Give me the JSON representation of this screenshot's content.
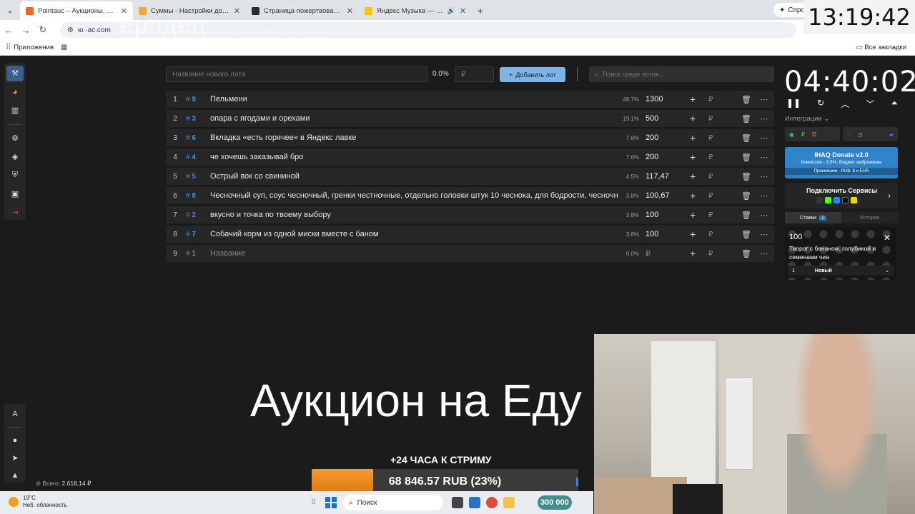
{
  "browser": {
    "tabs": [
      {
        "title": "Pointauc – Аукционы, лотереи",
        "color": "#e86a1f",
        "active": true
      },
      {
        "title": "Суммы - Настройки донатов",
        "color": "#f2a93b",
        "active": false
      },
      {
        "title": "Страница пожертвований | D",
        "color": "#2b2b2b",
        "active": false
      },
      {
        "title": "Яндекс Музыка — собира",
        "color": "#f5c518",
        "active": false,
        "audio": true
      }
    ],
    "ask_label": "Спрос",
    "url": "ю ·ac.com",
    "bookmarks_apps": "Приложения",
    "bookmarks_all": "Все закладки"
  },
  "overlay": {
    "clock": "13:19:42",
    "ghost_text": "ерлдец"
  },
  "toolbar": {
    "lot_name_placeholder": "Название нового лота",
    "percent": "0.0%",
    "price_placeholder": "₽",
    "add_label": "Добавить лот",
    "search_placeholder": "Поиск среди лотов..."
  },
  "lots": [
    {
      "num": "1",
      "id": "9",
      "name": "Пельмени",
      "pct": "49.7%",
      "amount": "1300"
    },
    {
      "num": "2",
      "id": "3",
      "name": "опара с ягодами и орехами",
      "pct": "19.1%",
      "amount": "500"
    },
    {
      "num": "3",
      "id": "6",
      "name": "Вкладка «есть горячее» в Яндекс лавке",
      "pct": "7.6%",
      "amount": "200"
    },
    {
      "num": "4",
      "id": "4",
      "name": "че хочешь заказывай бро",
      "pct": "7.6%",
      "amount": "200"
    },
    {
      "num": "5",
      "id": "5",
      "name": "Острый вок со свининой",
      "pct": "4.5%",
      "amount": "117,47"
    },
    {
      "num": "6",
      "id": "8",
      "name": "Чесночный суп, соус чесночный, гренки честночные,  отдельно головки штук 10 чеснока, для бодрости, чесночны",
      "pct": "3.8%",
      "amount": "100,67"
    },
    {
      "num": "7",
      "id": "2",
      "name": "вкусно и точка по твоему выбору",
      "pct": "3.8%",
      "amount": "100"
    },
    {
      "num": "8",
      "id": "7",
      "name": "Собачий корм из одной миски вместе с баном",
      "pct": "3.8%",
      "amount": "100"
    },
    {
      "num": "9",
      "id": "1",
      "name": "Название",
      "pct": "0.0%",
      "amount": "₽",
      "empty": true
    }
  ],
  "lot_currency": "₽",
  "timer": "04:40:02",
  "integrations_label": "Интеграции",
  "ihaq": {
    "title": "IHAQ Donate v2.0",
    "subtitle": "Комиссия - 3,5%, Виджет нейромемы",
    "accepts": "Принимаем - RUB, $ и EUR"
  },
  "connect_label": "Подключить Сервисы",
  "bids": {
    "tab_bids": "Ставки",
    "tab_bids_count": "1",
    "tab_history": "История",
    "card_amount": "100",
    "card_message": "Творог с бананом, голубикой и семенами чиа",
    "card_select_num": "1",
    "card_select_label": "Новый"
  },
  "main_title": "Аукцион на Еду",
  "stream_plus": "+24 ЧАСА К СТРИМУ",
  "goal": {
    "label": "68 846.57 RUB (23%)",
    "progress": 0.23
  },
  "total": {
    "label": "Всего:",
    "value": "2.618,14 ₽"
  },
  "taskbar": {
    "temp": "19°C",
    "weather": "Неб. облачность",
    "zero": "0",
    "search": "Поиск",
    "count": "300 000"
  }
}
